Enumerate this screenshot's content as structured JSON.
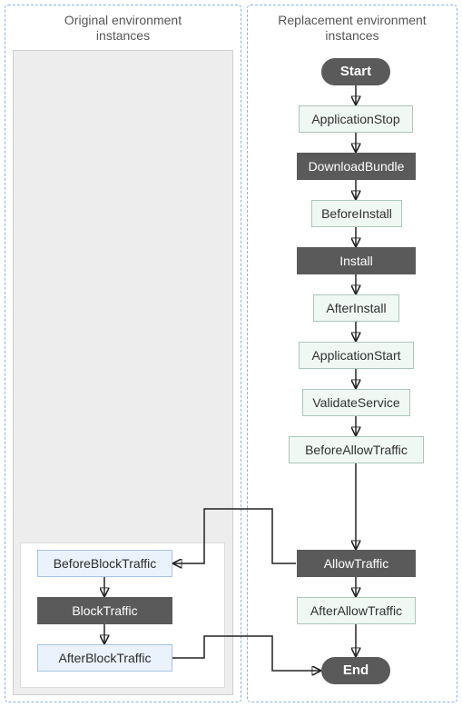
{
  "panels": {
    "original": {
      "title": "Original environment\ninstances"
    },
    "replacement": {
      "title": "Replacement environment\ninstances"
    }
  },
  "right_flow": {
    "start": "Start",
    "application_stop": "ApplicationStop",
    "download_bundle": "DownloadBundle",
    "before_install": "BeforeInstall",
    "install": "Install",
    "after_install": "AfterInstall",
    "application_start": "ApplicationStart",
    "validate_service": "ValidateService",
    "before_allow": "BeforeAllowTraffic",
    "allow_traffic": "AllowTraffic",
    "after_allow": "AfterAllowTraffic",
    "end": "End"
  },
  "left_flow": {
    "before_block": "BeforeBlockTraffic",
    "block_traffic": "BlockTraffic",
    "after_block": "AfterBlockTraffic"
  },
  "styles": {
    "start_end": "dark-pill",
    "system": "dark",
    "hook_r": "light",
    "hook_l": "blue"
  }
}
